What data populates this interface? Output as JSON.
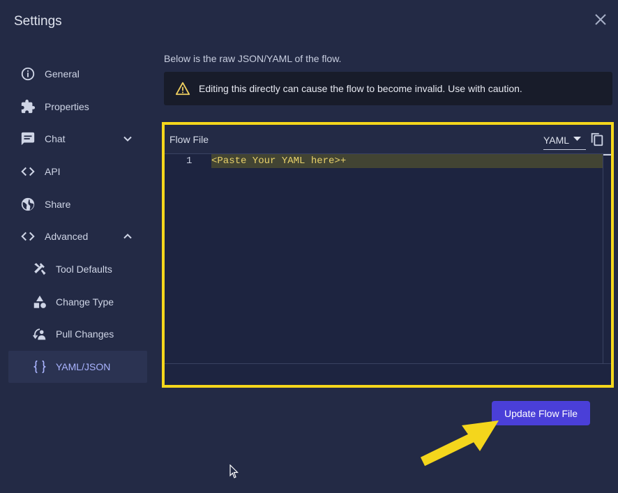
{
  "dialog": {
    "title": "Settings",
    "description": "Below is the raw JSON/YAML of the flow.",
    "warning": "Editing this directly can cause the flow to become invalid. Use with caution."
  },
  "sidebar": {
    "items": [
      {
        "label": "General",
        "icon": "info-icon"
      },
      {
        "label": "Properties",
        "icon": "puzzle-icon"
      },
      {
        "label": "Chat",
        "icon": "chat-icon",
        "expanded": false
      },
      {
        "label": "API",
        "icon": "code-icon"
      },
      {
        "label": "Share",
        "icon": "globe-icon"
      },
      {
        "label": "Advanced",
        "icon": "code-icon",
        "expanded": true
      },
      {
        "label": "Tool Defaults",
        "icon": "tools-icon"
      },
      {
        "label": "Change Type",
        "icon": "shapes-icon"
      },
      {
        "label": "Pull Changes",
        "icon": "pull-changes-icon"
      },
      {
        "label": "YAML/JSON",
        "icon": "braces-icon",
        "active": true
      }
    ]
  },
  "editor": {
    "title": "Flow File",
    "format": "YAML",
    "line_number": "1",
    "content": "<Paste Your YAML here>+"
  },
  "actions": {
    "update_label": "Update Flow File"
  },
  "colors": {
    "background": "#232a45",
    "accent": "#4a3fd8",
    "highlight_frame": "#f4d61c",
    "code_text": "#e9d26a"
  }
}
